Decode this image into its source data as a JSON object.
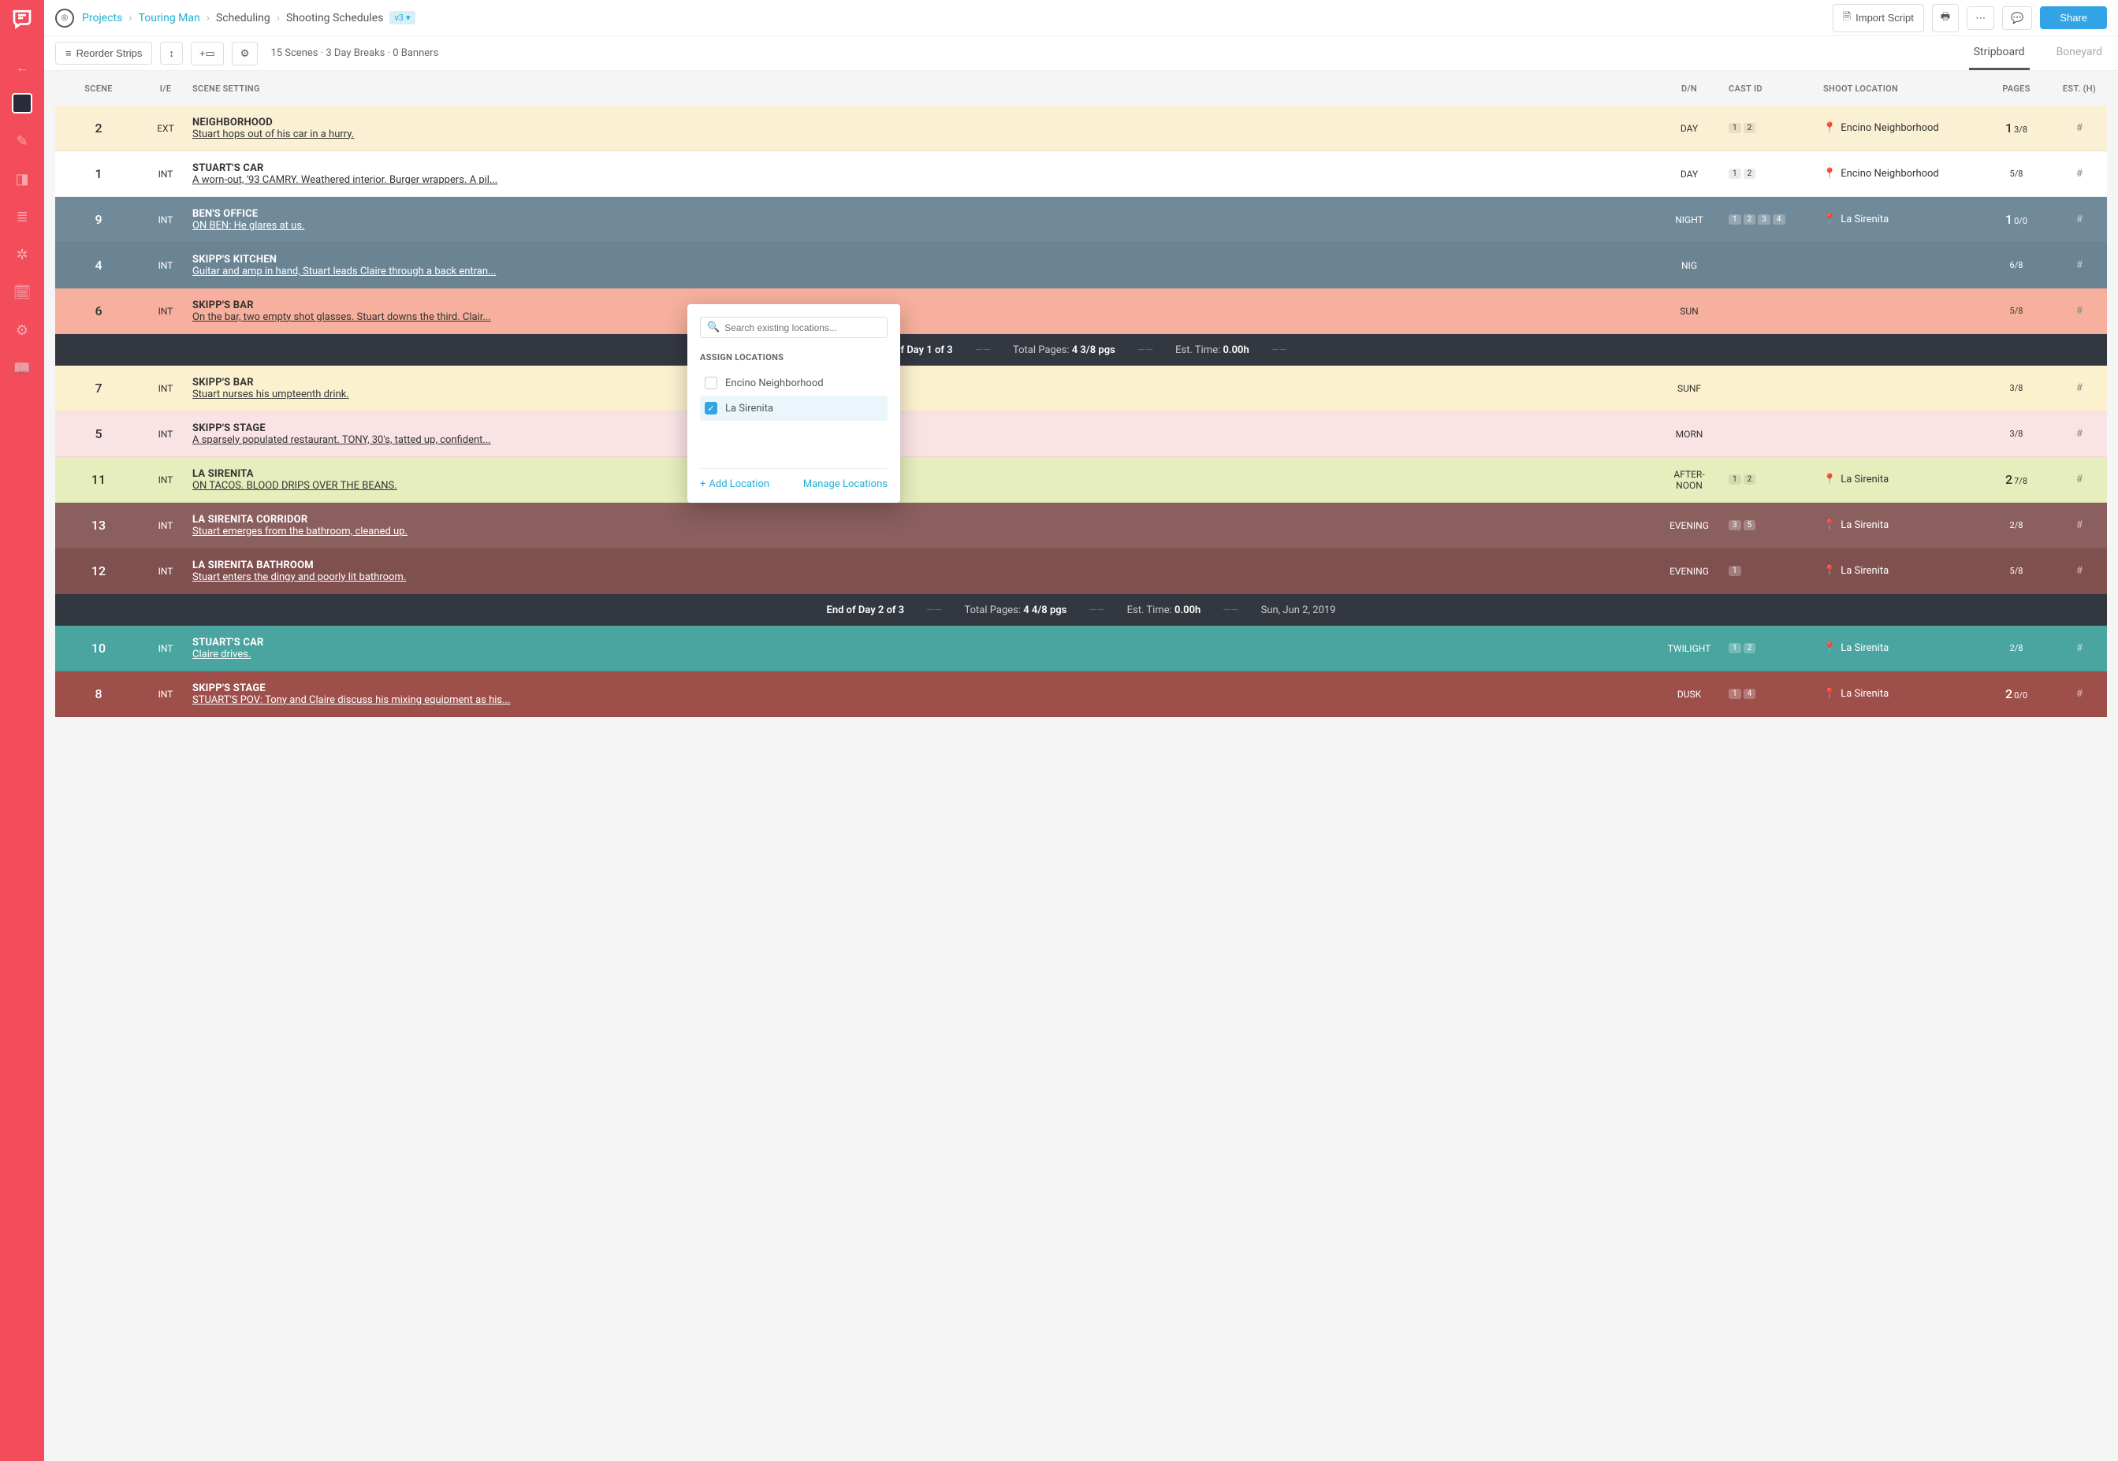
{
  "breadcrumb": {
    "projects": "Projects",
    "project": "Touring Man",
    "section": "Scheduling",
    "page": "Shooting Schedules",
    "version": "v3"
  },
  "header": {
    "import": "Import Script",
    "share": "Share"
  },
  "toolbar": {
    "reorder": "Reorder Strips",
    "summary": "15 Scenes · 3 Day Breaks · 0 Banners",
    "tab_stripboard": "Stripboard",
    "tab_boneyard": "Boneyard"
  },
  "columns": {
    "scene": "SCENE",
    "ie": "I/E",
    "setting": "SCENE SETTING",
    "dn": "D/N",
    "cast": "CAST ID",
    "loc": "SHOOT LOCATION",
    "pages": "PAGES",
    "est": "EST. (H)"
  },
  "strips": [
    {
      "scene": "2",
      "ie": "EXT",
      "title": "NEIGHBORHOOD",
      "desc": "Stuart hops out of his car in a hurry.",
      "dn": "DAY",
      "cast": [
        "1",
        "2"
      ],
      "loc": "Encino Neighborhood",
      "pages_big": "1",
      "pages_frac": "3/8",
      "est": "#",
      "cls": "c-cream",
      "dark": false
    },
    {
      "scene": "1",
      "ie": "INT",
      "title": "STUART'S CAR",
      "desc": "A worn-out, '93 CAMRY. Weathered interior. Burger wrappers. A pil...",
      "dn": "DAY",
      "cast": [
        "1",
        "2"
      ],
      "loc": "Encino Neighborhood",
      "pages_big": "",
      "pages_frac": "5/8",
      "est": "#",
      "cls": "c-white",
      "dark": false
    },
    {
      "scene": "9",
      "ie": "INT",
      "title": "BEN'S OFFICE",
      "desc": "ON BEN: He glares at us.",
      "dn": "NIGHT",
      "cast": [
        "1",
        "2",
        "3",
        "4"
      ],
      "loc": "La Sirenita",
      "pages_big": "1",
      "pages_frac": "0/0",
      "est": "#",
      "cls": "c-slate",
      "dark": true
    },
    {
      "scene": "4",
      "ie": "INT",
      "title": "SKIPP'S KITCHEN",
      "desc": "Guitar and amp in hand, Stuart leads Claire through a back entran...",
      "dn": "NIG",
      "cast": [],
      "loc": "",
      "pages_big": "",
      "pages_frac": "6/8",
      "est": "#",
      "cls": "c-slate2",
      "dark": true
    },
    {
      "scene": "6",
      "ie": "INT",
      "title": "SKIPP'S BAR",
      "desc": "On the bar, two empty shot glasses. Stuart downs the third. Clair...",
      "dn": "SUN",
      "cast": [],
      "loc": "",
      "pages_big": "",
      "pages_frac": "5/8",
      "est": "#",
      "cls": "c-salmon",
      "dark": false
    }
  ],
  "daybreak1": {
    "label": "End of Day 1 of 3",
    "pagesLabel": "Total Pages:",
    "pages": "4 3/8 pgs",
    "timeLabel": "Est. Time:",
    "time": "0.00h"
  },
  "strips2": [
    {
      "scene": "7",
      "ie": "INT",
      "title": "SKIPP'S BAR",
      "desc": "Stuart nurses his umpteenth drink.",
      "dn": "SUNF",
      "cast": [],
      "loc": "",
      "pages_big": "",
      "pages_frac": "3/8",
      "est": "#",
      "cls": "c-cream2",
      "dark": false
    },
    {
      "scene": "5",
      "ie": "INT",
      "title": "SKIPP'S STAGE",
      "desc": "A sparsely populated restaurant. TONY, 30's, tatted up, confident...",
      "dn": "MORN",
      "cast": [],
      "loc": "",
      "pages_big": "",
      "pages_frac": "3/8",
      "est": "#",
      "cls": "c-pink",
      "dark": false
    },
    {
      "scene": "11",
      "ie": "INT",
      "title": "LA SIRENITA",
      "desc": "ON TACOS. BLOOD DRIPS OVER THE BEANS.",
      "dn": "AFTER-\nNOON",
      "cast": [
        "1",
        "2"
      ],
      "loc": "La Sirenita",
      "pages_big": "2",
      "pages_frac": "7/8",
      "est": "#",
      "cls": "c-lime",
      "dark": false
    },
    {
      "scene": "13",
      "ie": "INT",
      "title": "LA SIRENITA CORRIDOR",
      "desc": "Stuart emerges from the bathroom, cleaned up.",
      "dn": "EVENING",
      "cast": [
        "3",
        "5"
      ],
      "loc": "La Sirenita",
      "pages_big": "",
      "pages_frac": "2/8",
      "est": "#",
      "cls": "c-brown",
      "dark": true
    },
    {
      "scene": "12",
      "ie": "INT",
      "title": "LA SIRENITA BATHROOM",
      "desc": "Stuart enters the dingy and poorly lit bathroom.",
      "dn": "EVENING",
      "cast": [
        "1"
      ],
      "loc": "La Sirenita",
      "pages_big": "",
      "pages_frac": "5/8",
      "est": "#",
      "cls": "c-brown2",
      "dark": true
    }
  ],
  "daybreak2": {
    "label": "End of Day 2 of 3",
    "pagesLabel": "Total Pages:",
    "pages": "4 4/8 pgs",
    "timeLabel": "Est. Time:",
    "time": "0.00h",
    "date": "Sun, Jun 2, 2019"
  },
  "strips3": [
    {
      "scene": "10",
      "ie": "INT",
      "title": "STUART'S CAR",
      "desc": "Claire drives.",
      "dn": "TWILIGHT",
      "cast": [
        "1",
        "2"
      ],
      "loc": "La Sirenita",
      "pages_big": "",
      "pages_frac": "2/8",
      "est": "#",
      "cls": "c-teal",
      "dark": true
    },
    {
      "scene": "8",
      "ie": "INT",
      "title": "SKIPP'S STAGE",
      "desc": "STUART'S POV: Tony and Claire discuss his mixing equipment as his...",
      "dn": "DUSK",
      "cast": [
        "1",
        "4"
      ],
      "loc": "La Sirenita",
      "pages_big": "2",
      "pages_frac": "0/0",
      "est": "#",
      "cls": "c-maroon",
      "dark": true
    }
  ],
  "popup": {
    "placeholder": "Search existing locations...",
    "heading": "ASSIGN LOCATIONS",
    "opt1": "Encino Neighborhood",
    "opt2": "La Sirenita",
    "add": "Add Location",
    "manage": "Manage Locations"
  },
  "est_placeholder": "#"
}
